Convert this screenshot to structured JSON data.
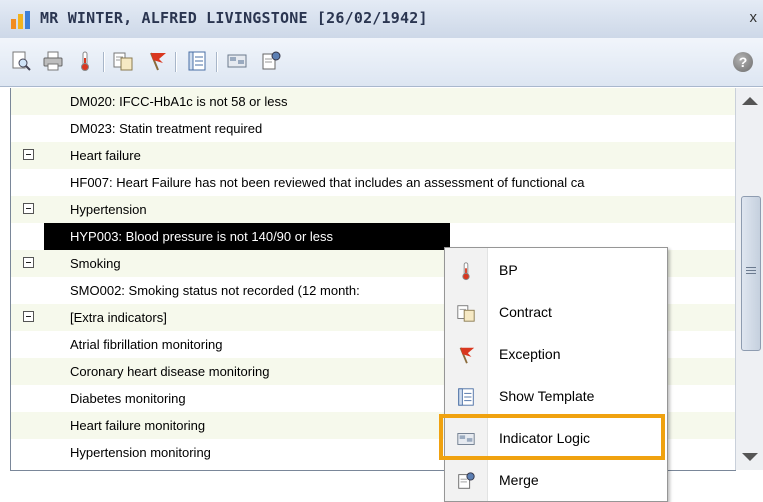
{
  "window": {
    "title": "MR WINTER, ALFRED LIVINGSTONE [26/02/1942]",
    "close_glyph": "x"
  },
  "toolbar": {
    "buttons": [
      {
        "icon": "print-preview-icon"
      },
      {
        "icon": "printer-icon"
      },
      {
        "icon": "thermometer-icon"
      },
      {
        "icon": "contract-icon"
      },
      {
        "icon": "exception-flag-icon"
      },
      {
        "icon": "template-icon"
      },
      {
        "icon": "indicator-logic-icon"
      },
      {
        "icon": "merge-icon"
      }
    ],
    "help_glyph": "?"
  },
  "list": {
    "rows": [
      {
        "text": "DM020: IFCC-HbA1c is not 58 or less",
        "type": "indicator"
      },
      {
        "text": "DM023: Statin treatment required",
        "type": "indicator"
      },
      {
        "text": "Heart failure",
        "type": "group"
      },
      {
        "text": "HF007: Heart Failure has not been reviewed that includes an assessment of functional ca",
        "type": "indicator"
      },
      {
        "text": "Hypertension",
        "type": "group"
      },
      {
        "text": "HYP003: Blood pressure is not 140/90 or less",
        "type": "selected"
      },
      {
        "text": "Smoking",
        "type": "group"
      },
      {
        "text": "SMO002: Smoking status not recorded (12 month:",
        "type": "indicator"
      },
      {
        "text": "[Extra indicators]",
        "type": "group"
      },
      {
        "text": "Atrial fibrillation monitoring",
        "type": "indicator"
      },
      {
        "text": "Coronary heart disease monitoring",
        "type": "indicator"
      },
      {
        "text": "Diabetes monitoring",
        "type": "indicator"
      },
      {
        "text": "Heart failure monitoring",
        "type": "indicator"
      },
      {
        "text": "Hypertension monitoring",
        "type": "indicator"
      }
    ]
  },
  "context_menu": {
    "items": [
      {
        "label": "BP",
        "icon": "thermometer-icon"
      },
      {
        "label": "Contract",
        "icon": "contract-icon"
      },
      {
        "label": "Exception",
        "icon": "exception-flag-icon"
      },
      {
        "label": "Show Template",
        "icon": "template-icon"
      },
      {
        "label": "Indicator Logic",
        "icon": "indicator-logic-icon",
        "highlighted": true
      },
      {
        "label": "Merge",
        "icon": "merge-icon"
      }
    ]
  },
  "colors": {
    "highlight_border": "#f0a20f",
    "selected_row_bg": "#000000",
    "alt_row_bg": "#f6f9ec",
    "flag_red": "#d9371f"
  }
}
